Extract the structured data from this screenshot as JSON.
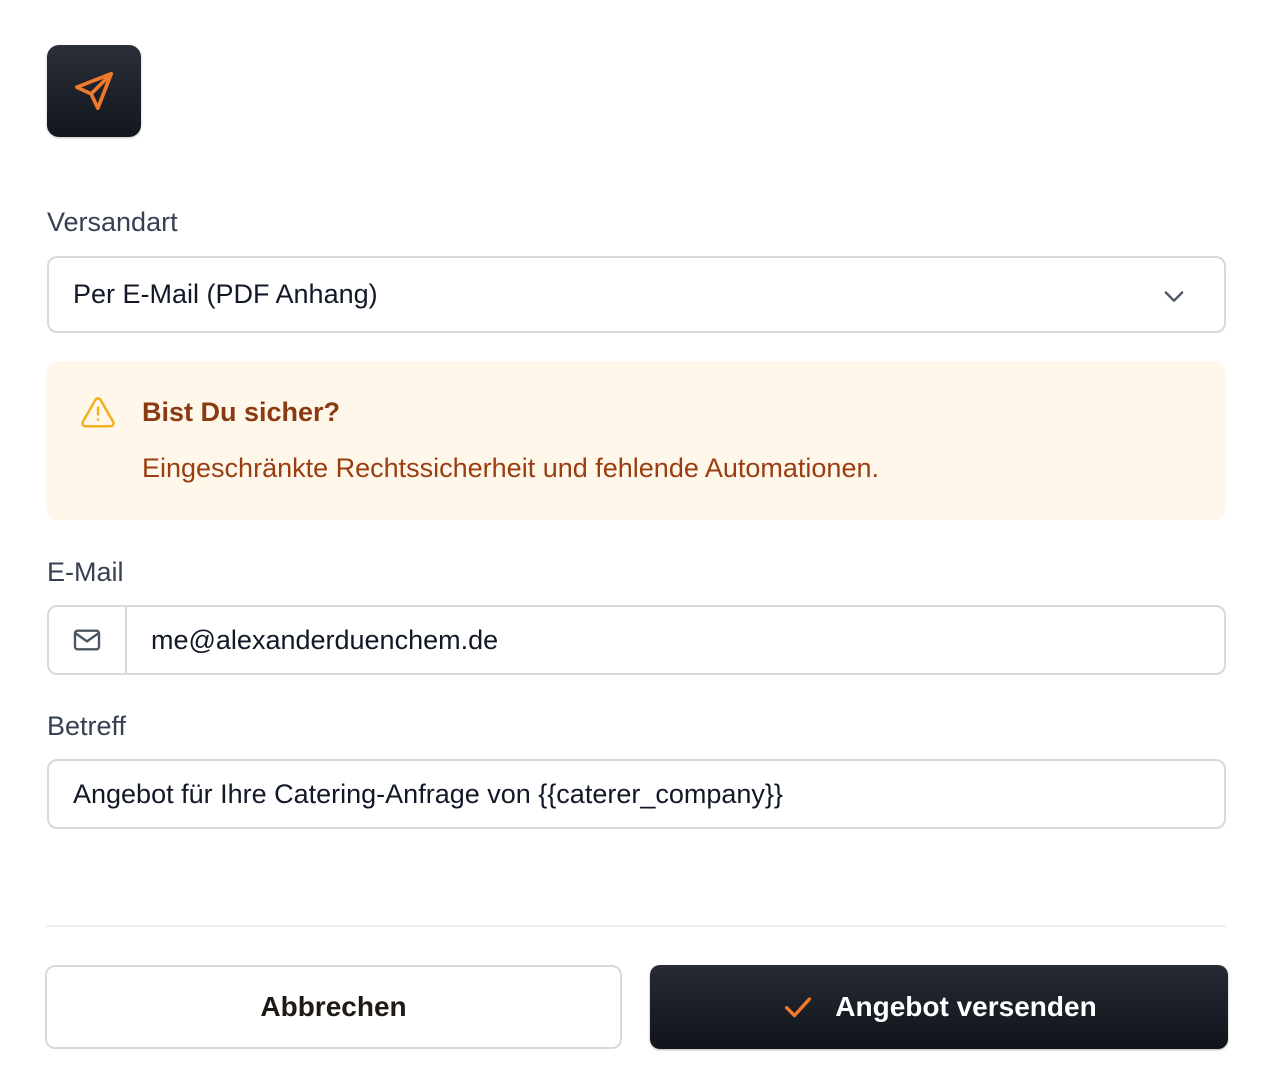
{
  "header": {
    "icon": "send-icon",
    "accent_color": "#f07a2c"
  },
  "versandart": {
    "label": "Versandart",
    "selected_value": "Per E-Mail (PDF Anhang)"
  },
  "alert": {
    "icon": "warning-triangle-icon",
    "title": "Bist Du sicher?",
    "message": "Eingeschränkte Rechtssicherheit und fehlende Automationen.",
    "background": "#fff8ea",
    "text_color": "#9a3d10"
  },
  "email": {
    "label": "E-Mail",
    "icon": "mail-icon",
    "value": "me@alexanderduenchem.de"
  },
  "subject": {
    "label": "Betreff",
    "value": "Angebot für Ihre Catering-Anfrage von {{caterer_company}}"
  },
  "actions": {
    "cancel_label": "Abbrechen",
    "send_label": "Angebot versenden",
    "send_icon": "check-icon"
  }
}
